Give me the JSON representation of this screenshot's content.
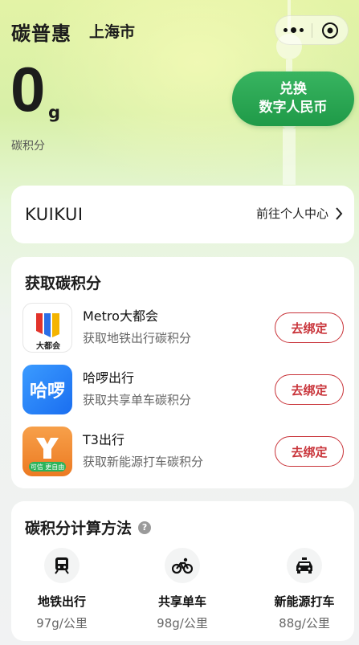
{
  "header": {
    "app_title": "碳普惠",
    "city": "上海市"
  },
  "points": {
    "value": "0",
    "unit": "g",
    "label": "碳积分"
  },
  "exchange": {
    "line1": "兑换",
    "line2": "数字人民币"
  },
  "user": {
    "name": "KUIKUI",
    "profile_link": "前往个人中心"
  },
  "earn": {
    "title": "获取碳积分",
    "partners": [
      {
        "name": "Metro大都会",
        "desc": "获取地铁出行碳积分",
        "button": "去绑定",
        "logo_text": "大都会",
        "icon": "metro-logo-icon"
      },
      {
        "name": "哈啰出行",
        "desc": "获取共享单车碳积分",
        "button": "去绑定",
        "logo_text": "哈啰",
        "icon": "hellobike-logo-icon"
      },
      {
        "name": "T3出行",
        "desc": "获取新能源打车碳积分",
        "button": "去绑定",
        "logo_text": "可信 更自由",
        "icon": "t3-logo-icon"
      }
    ]
  },
  "calc": {
    "title": "碳积分计算方法",
    "help_icon": "?",
    "modes": [
      {
        "label": "地铁出行",
        "rate": "97g/公里",
        "icon": "metro-train-icon"
      },
      {
        "label": "共享单车",
        "rate": "98g/公里",
        "icon": "bicycle-icon"
      },
      {
        "label": "新能源打车",
        "rate": "88g/公里",
        "icon": "taxi-icon"
      }
    ]
  },
  "colors": {
    "accent_green": "#1f9a48",
    "bind_red": "#c9343a",
    "hellobike_blue": "#1a7cf5",
    "t3_orange": "#f08a2c"
  }
}
